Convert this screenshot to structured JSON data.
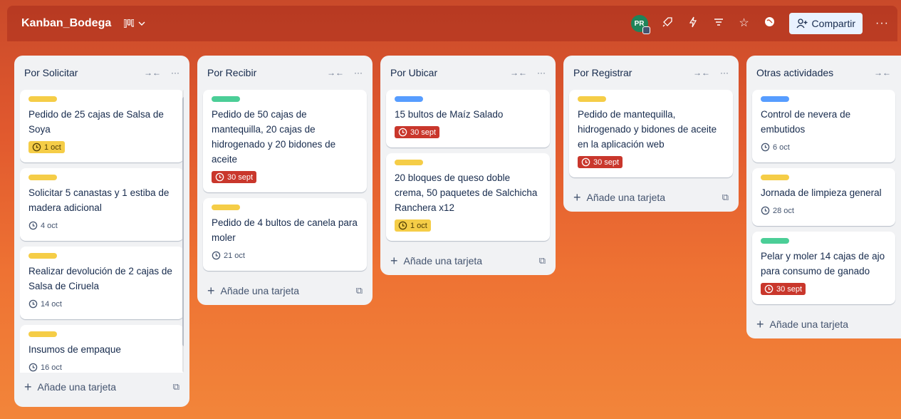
{
  "board": {
    "title": "Kanban_Bodega",
    "avatar_initials": "PR",
    "share_label": "Compartir",
    "icons": [
      "board-view-icon",
      "chevron-down-icon",
      "rocket-icon",
      "lightning-icon",
      "filter-icon",
      "star-icon",
      "globe-icon",
      "add-person-icon",
      "more-icon"
    ]
  },
  "colors": {
    "label_yellow": "#f5cd47",
    "label_green": "#4bce97",
    "label_blue": "#579dff",
    "due_yellow": "#f5cd47",
    "due_red": "#c9372c"
  },
  "add_card_label": "Añade una tarjeta",
  "lists": [
    {
      "title": "Por Solicitar",
      "cards": [
        {
          "label": "yellow",
          "text": "Pedido de 25 cajas de Salsa de Soya",
          "due": "1 oct",
          "due_style": "yellow"
        },
        {
          "label": "yellow",
          "text": "Solicitar 5 canastas y 1 estiba de madera adicional",
          "due": "4 oct",
          "due_style": "plain"
        },
        {
          "label": "yellow",
          "text": "Realizar devolución de 2 cajas de Salsa de Ciruela",
          "due": "14 oct",
          "due_style": "plain"
        },
        {
          "label": "yellow",
          "text": "Insumos de empaque",
          "due": "16 oct",
          "due_style": "plain"
        }
      ]
    },
    {
      "title": "Por Recibir",
      "cards": [
        {
          "label": "green",
          "text": "Pedido de 50 cajas de mantequilla, 20 cajas de hidrogenado y 20 bidones de aceite",
          "due": "30 sept",
          "due_style": "red"
        },
        {
          "label": "yellow",
          "text": "Pedido de 4 bultos de canela para moler",
          "due": "21 oct",
          "due_style": "plain"
        }
      ]
    },
    {
      "title": "Por Ubicar",
      "cards": [
        {
          "label": "blue",
          "text": "15 bultos de Maíz Salado",
          "due": "30 sept",
          "due_style": "red"
        },
        {
          "label": "yellow",
          "text": "20 bloques de queso doble crema, 50 paquetes de Salchicha Ranchera x12",
          "due": "1 oct",
          "due_style": "yellow"
        }
      ]
    },
    {
      "title": "Por Registrar",
      "cards": [
        {
          "label": "yellow",
          "text": "Pedido de mantequilla, hidrogenado y bidones de aceite en la aplicación web",
          "due": "30 sept",
          "due_style": "red"
        }
      ]
    },
    {
      "title": "Otras actividades",
      "cards": [
        {
          "label": "blue",
          "text": "Control de nevera de embutidos",
          "due": "6 oct",
          "due_style": "plain"
        },
        {
          "label": "yellow",
          "text": "Jornada de limpieza general",
          "due": "28 oct",
          "due_style": "plain"
        },
        {
          "label": "green",
          "text": "Pelar y moler 14 cajas de ajo para consumo de ganado",
          "due": "30 sept",
          "due_style": "red"
        }
      ]
    }
  ]
}
